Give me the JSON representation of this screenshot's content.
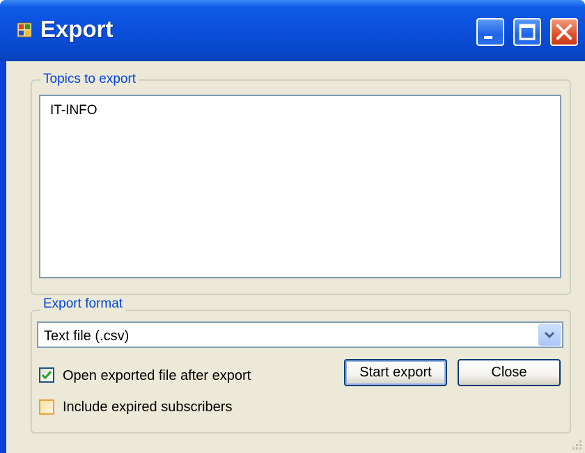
{
  "window": {
    "title": "Export",
    "icon": "app-window-icon",
    "controls": [
      "minimize-icon",
      "maximize-icon",
      "close-icon"
    ]
  },
  "topics_group": {
    "legend": "Topics to export",
    "items": [
      "IT-INFO"
    ]
  },
  "format_group": {
    "legend": "Export format",
    "selected_format": "Text file (.csv)"
  },
  "options": {
    "open_after_export": {
      "label": "Open exported file after export",
      "checked": true
    },
    "include_expired": {
      "label": "Include expired subscribers",
      "checked": false
    }
  },
  "buttons": {
    "start_export": "Start export",
    "close": "Close"
  },
  "colors": {
    "titlebar": "#0a4ed8",
    "client_bg": "#ece9d8",
    "legend_text": "#0046d5",
    "close_button": "#e0502a"
  }
}
